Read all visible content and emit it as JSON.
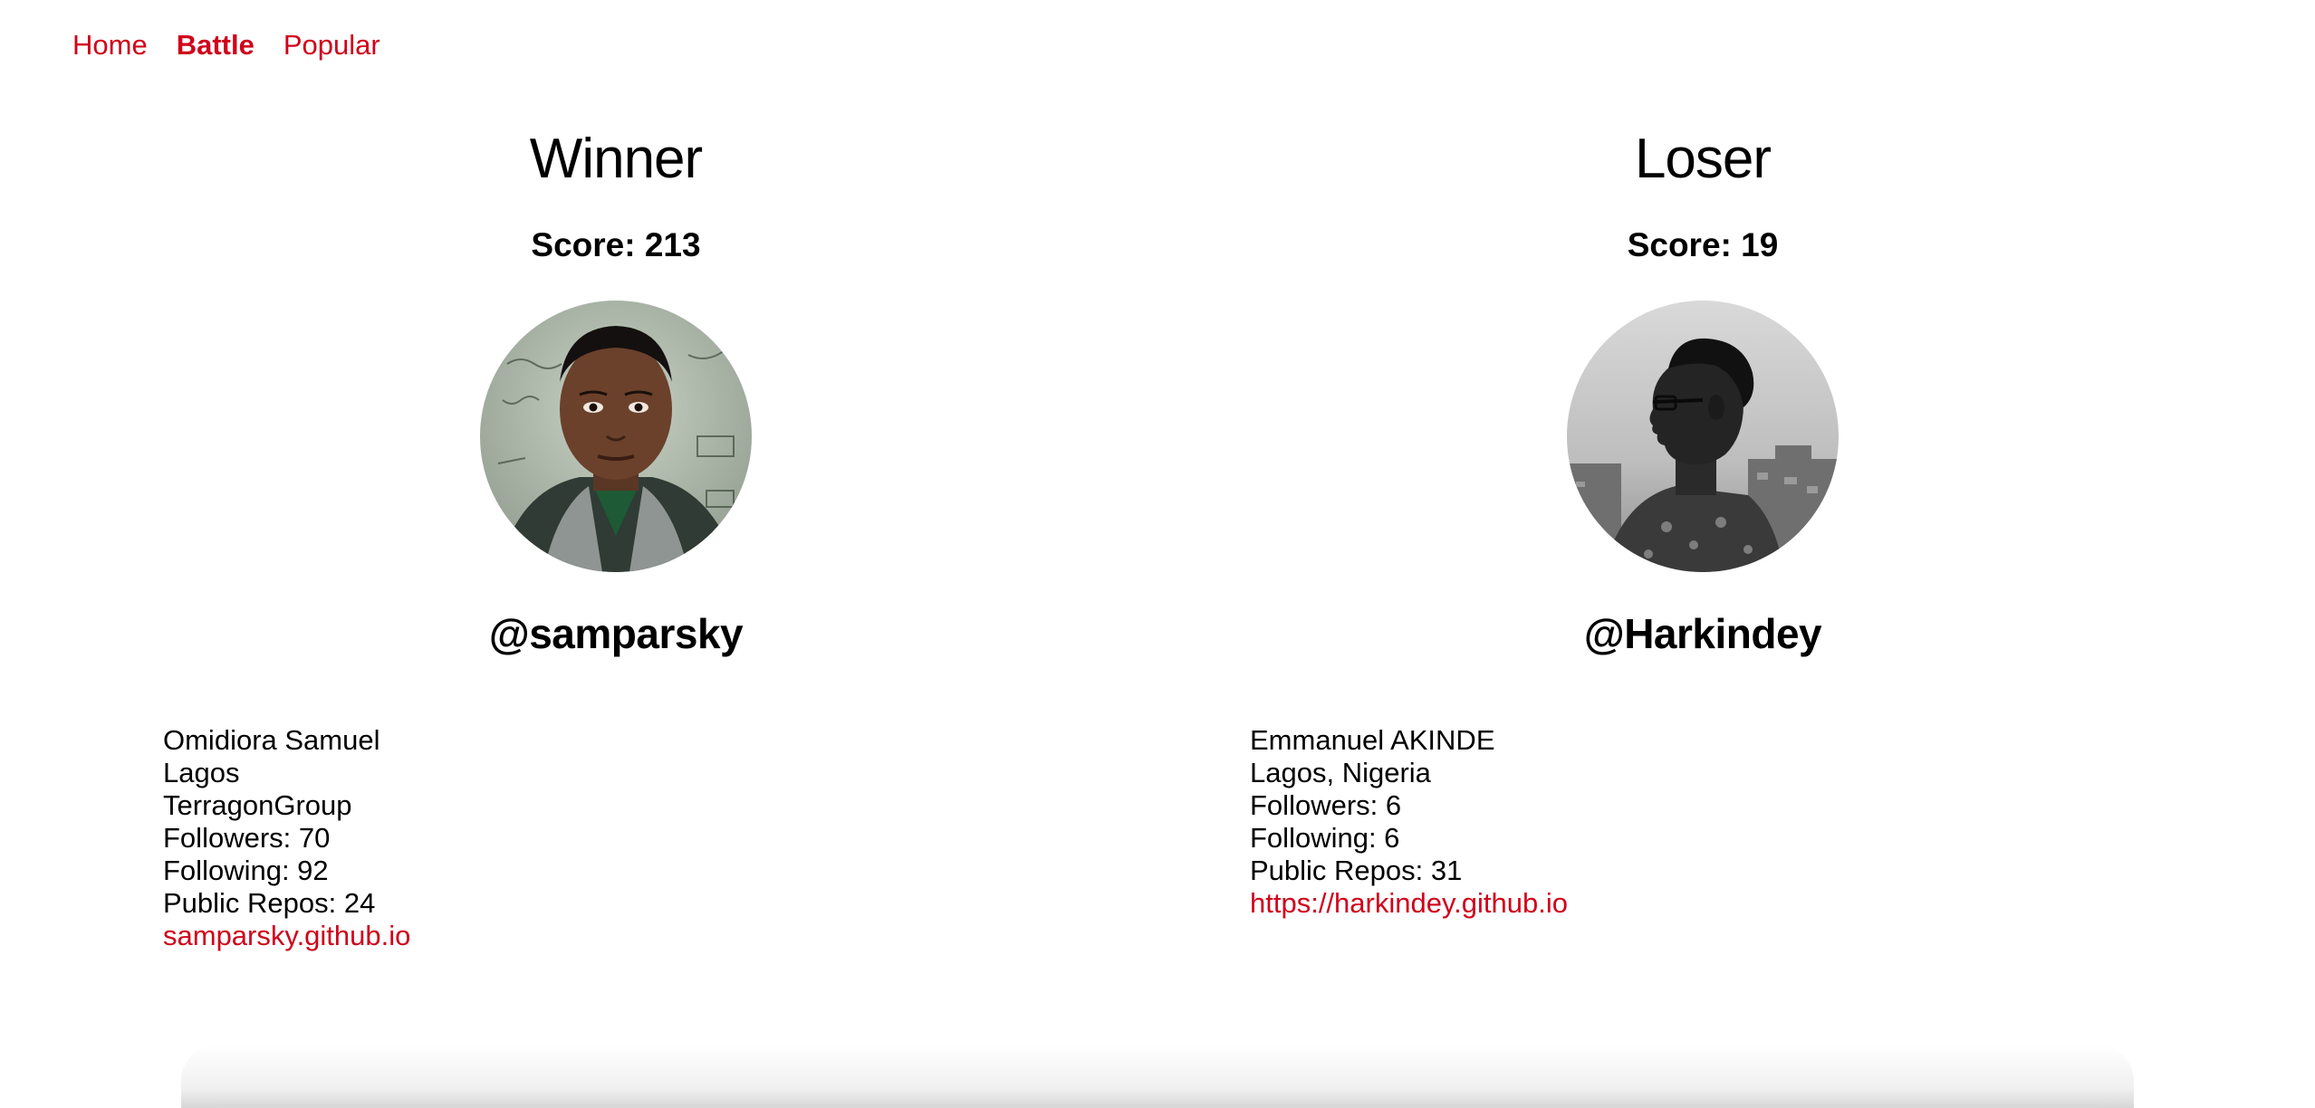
{
  "nav": {
    "items": [
      {
        "label": "Home",
        "active": false
      },
      {
        "label": "Battle",
        "active": true
      },
      {
        "label": "Popular",
        "active": false
      }
    ]
  },
  "players": [
    {
      "result": "Winner",
      "score": "Score: 213",
      "username": "@samparsky",
      "avatar": "samparsky-avatar",
      "name": "Omidiora Samuel",
      "location": "Lagos",
      "company": "TerragonGroup",
      "followers": "Followers: 70",
      "following": "Following: 92",
      "repos": "Public Repos: 24",
      "blog": "samparsky.github.io"
    },
    {
      "result": "Loser",
      "score": "Score: 19",
      "username": "@Harkindey",
      "avatar": "harkindey-avatar",
      "name": "Emmanuel AKINDE",
      "location": "Lagos, Nigeria",
      "followers": "Followers: 6",
      "following": "Following: 6",
      "repos": "Public Repos: 31",
      "blog": "https://harkindey.github.io"
    }
  ],
  "colors": {
    "accent": "#d0021b",
    "text": "#000000",
    "background": "#ffffff"
  }
}
